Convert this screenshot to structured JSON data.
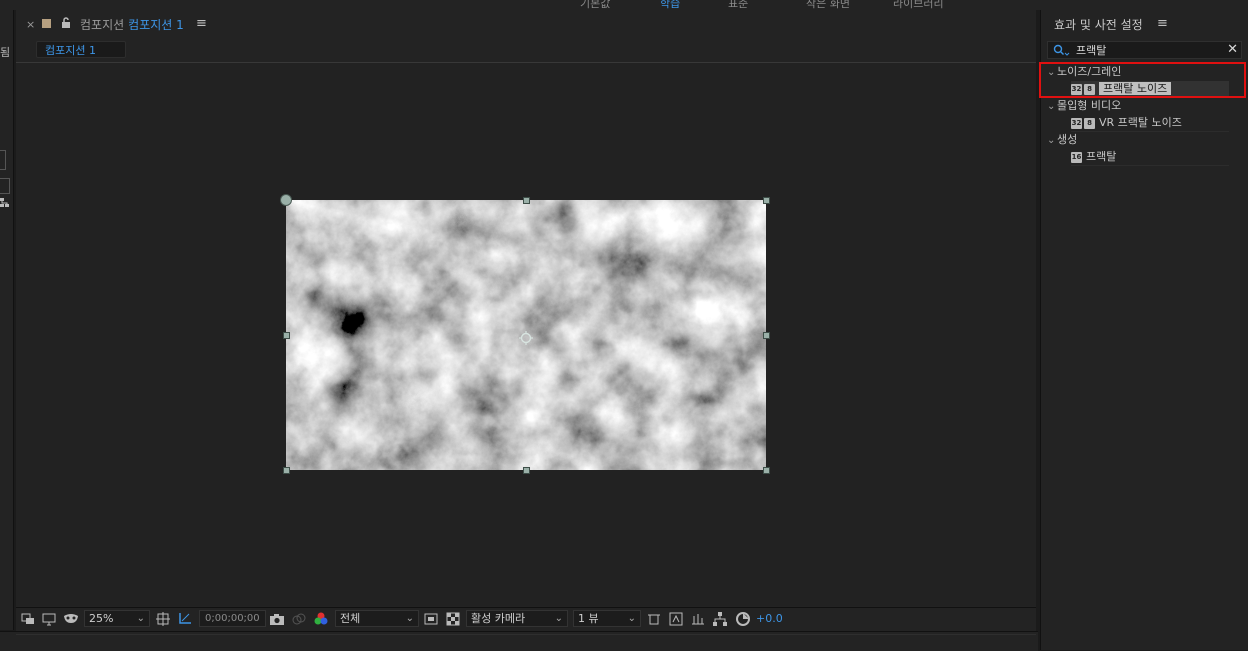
{
  "top_strip": {
    "tabs": [
      "기본값",
      "학습",
      "표준",
      "작은 화면",
      "라이브러리"
    ]
  },
  "left_panel": {
    "fragment": "됨"
  },
  "composition": {
    "close": "×",
    "title_prefix": "컴포지션",
    "title_active": "컴포지션 1",
    "menu": "≡",
    "subtab": "컴포지션 1"
  },
  "viewer_toolbar": {
    "zoom": "25%",
    "timecode": "0;00;00;00",
    "resolution": "전체",
    "camera": "활성 카메라",
    "views": "1 뷰",
    "exposure": "+0.0",
    "chevron": "⌄"
  },
  "effects_panel": {
    "title": "효과 및 사전 설정",
    "menu": "≡",
    "search_value": "프랙탈",
    "clear": "✕",
    "tree": [
      {
        "category": "노이즈/그레인",
        "items": [
          {
            "badges": [
              "32",
              "8"
            ],
            "name": "프랙탈 노이즈",
            "selected": true
          }
        ]
      },
      {
        "category": "몰입형 비디오",
        "items": [
          {
            "badges": [
              "32",
              "8"
            ],
            "name": "VR 프랙탈 노이즈",
            "selected": false
          }
        ]
      },
      {
        "category": "생성",
        "items": [
          {
            "badges": [
              "16"
            ],
            "name": "프랙탈",
            "selected": false
          }
        ]
      }
    ]
  },
  "colors": {
    "accent_blue": "#3d95e6",
    "highlight_red": "#e01010",
    "panel_bg": "#232323"
  },
  "icons": [
    "lock-icon",
    "search-icon",
    "camera-icon",
    "grid-icon",
    "flowchart-icon",
    "reset-exposure-icon"
  ]
}
